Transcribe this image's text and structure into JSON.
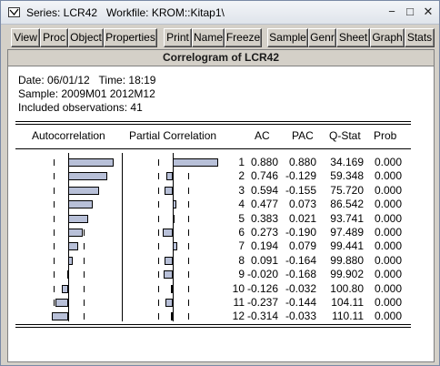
{
  "window": {
    "title": "Series: LCR42   Workfile: KROM::Kitap1\\",
    "controls": {
      "minimize": "−",
      "maximize": "□",
      "close": "✕"
    }
  },
  "toolbar": {
    "buttons": [
      "View",
      "Proc",
      "Object",
      "Properties",
      "Print",
      "Name",
      "Freeze",
      "Sample",
      "Genr",
      "Sheet",
      "Graph",
      "Stats"
    ]
  },
  "output": {
    "title": "Correlogram of LCR42",
    "date_line": "Date: 06/01/12   Time: 18:19",
    "sample_line": "Sample: 2009M01 2012M12",
    "obs_line": "Included observations: 41",
    "headers": {
      "autocorrelation": "Autocorrelation",
      "partial_correlation": "Partial Correlation",
      "ac": "AC",
      "pac": "PAC",
      "qstat": "Q-Stat",
      "prob": "Prob"
    },
    "rows": [
      {
        "lag": "1",
        "ac": "0.880",
        "pac": "0.880",
        "qstat": "34.169",
        "prob": "0.000"
      },
      {
        "lag": "2",
        "ac": "0.746",
        "pac": "-0.129",
        "qstat": "59.348",
        "prob": "0.000"
      },
      {
        "lag": "3",
        "ac": "0.594",
        "pac": "-0.155",
        "qstat": "75.720",
        "prob": "0.000"
      },
      {
        "lag": "4",
        "ac": "0.477",
        "pac": "0.073",
        "qstat": "86.542",
        "prob": "0.000"
      },
      {
        "lag": "5",
        "ac": "0.383",
        "pac": "0.021",
        "qstat": "93.741",
        "prob": "0.000"
      },
      {
        "lag": "6",
        "ac": "0.273",
        "pac": "-0.190",
        "qstat": "97.489",
        "prob": "0.000"
      },
      {
        "lag": "7",
        "ac": "0.194",
        "pac": "0.079",
        "qstat": "99.441",
        "prob": "0.000"
      },
      {
        "lag": "8",
        "ac": "0.091",
        "pac": "-0.164",
        "qstat": "99.880",
        "prob": "0.000"
      },
      {
        "lag": "9",
        "ac": "-0.020",
        "pac": "-0.168",
        "qstat": "99.902",
        "prob": "0.000"
      },
      {
        "lag": "10",
        "ac": "-0.126",
        "pac": "-0.032",
        "qstat": "100.80",
        "prob": "0.000"
      },
      {
        "lag": "11",
        "ac": "-0.237",
        "pac": "-0.144",
        "qstat": "104.11",
        "prob": "0.000"
      },
      {
        "lag": "12",
        "ac": "-0.314",
        "pac": "-0.033",
        "qstat": "110.11",
        "prob": "0.000"
      }
    ]
  }
}
